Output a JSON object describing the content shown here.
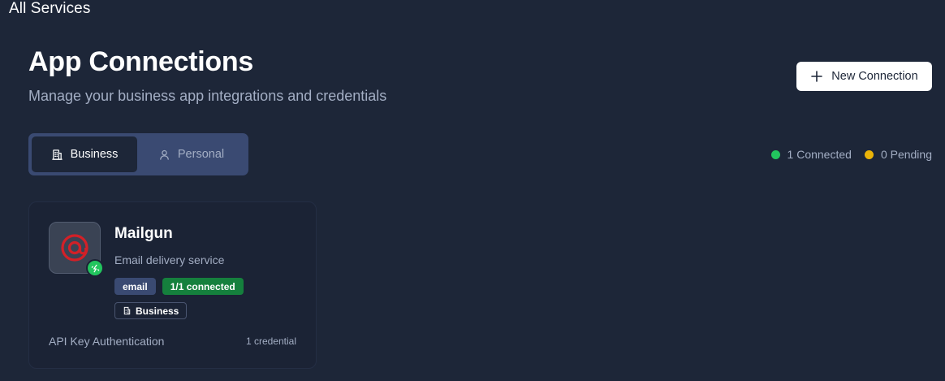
{
  "breadcrumb": "All Services",
  "header": {
    "title": "App Connections",
    "subtitle": "Manage your business app integrations and credentials",
    "new_button_label": "New Connection"
  },
  "tabs": [
    {
      "label": "Business",
      "active": true,
      "icon": "building-icon"
    },
    {
      "label": "Personal",
      "active": false,
      "icon": "user-icon"
    }
  ],
  "status_summary": {
    "connected": {
      "label": "1 Connected",
      "color": "#22c55e"
    },
    "pending": {
      "label": "0 Pending",
      "color": "#eab308"
    }
  },
  "connections": [
    {
      "name": "Mailgun",
      "description": "Email delivery service",
      "icon": "mailgun-icon",
      "status_icon": "connected-icon",
      "tags": {
        "category": "email",
        "connected": "1/1 connected",
        "scope": "Business"
      },
      "auth_type": "API Key Authentication",
      "credential_count": "1 credential"
    }
  ],
  "colors": {
    "background": "#1d2638",
    "accent": "#3a4a72",
    "success": "#22c55e",
    "success_dark": "#15803d",
    "mailgun_red": "#d32027"
  }
}
